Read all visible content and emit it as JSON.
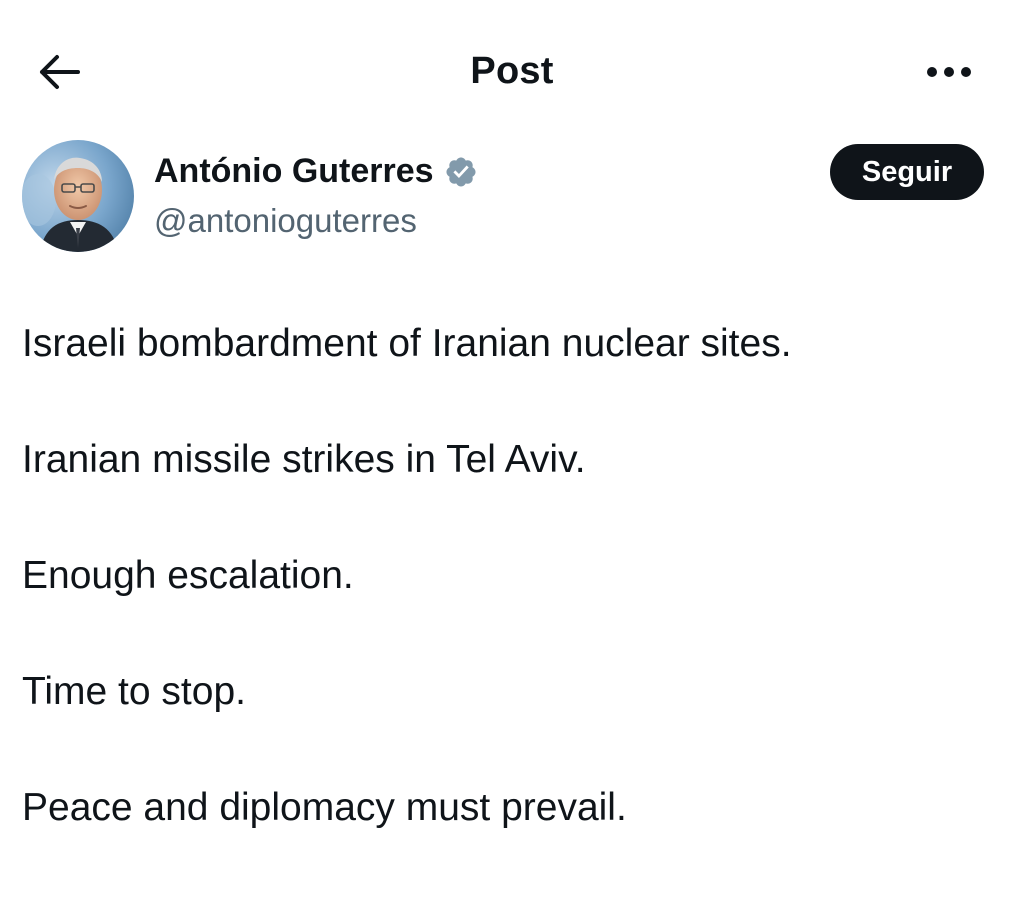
{
  "header": {
    "title": "Post",
    "back_icon": "arrow-left-icon",
    "more_icon": "more-horizontal-icon"
  },
  "author": {
    "name": "António Guterres",
    "handle": "@antonioguterres",
    "verified_icon": "verified-badge-icon",
    "verified_color": "#829aab",
    "follow_label": "Seguir"
  },
  "post": {
    "paragraphs": [
      "Israeli bombardment of Iranian nuclear sites.",
      "Iranian missile strikes in Tel Aviv.",
      "Enough escalation.",
      "Time to stop.",
      "Peace and diplomacy must prevail."
    ]
  },
  "colors": {
    "text": "#0f1419",
    "secondary_text": "#536471",
    "follow_bg": "#0f1419",
    "follow_text": "#ffffff"
  }
}
